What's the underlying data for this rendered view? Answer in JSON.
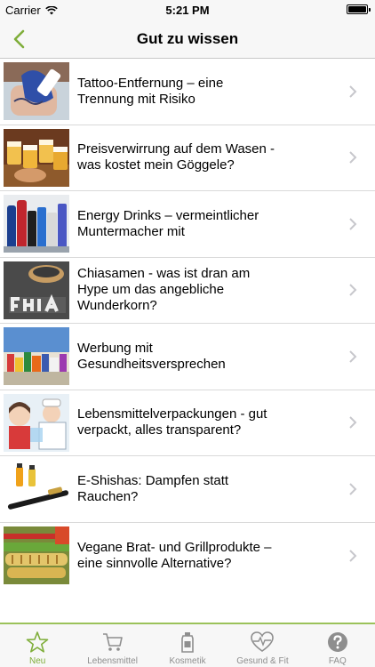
{
  "status": {
    "carrier": "Carrier",
    "time": "5:21 PM"
  },
  "nav": {
    "title": "Gut zu wissen"
  },
  "articles": [
    {
      "title": "Tattoo-Entfernung – eine Trennung mit Risiko",
      "thumb": "tattoo-removal-photo"
    },
    {
      "title": "Preisverwirrung auf dem Wasen - was kostet mein Göggele?",
      "thumb": "beer-festival-photo"
    },
    {
      "title": "Energy Drinks – vermeintlicher Muntermacher mit",
      "thumb": "energy-drinks-photo"
    },
    {
      "title": "Chiasamen - was ist dran am Hype um das angebliche Wunderkorn?",
      "thumb": "chia-seeds-photo"
    },
    {
      "title": "Werbung mit Gesundheitsversprechen",
      "thumb": "health-products-photo"
    },
    {
      "title": "Lebensmittelverpackungen - gut verpackt, alles transparent?",
      "thumb": "packaging-illustration"
    },
    {
      "title": "E-Shishas: Dampfen statt Rauchen?",
      "thumb": "e-shisha-photo"
    },
    {
      "title": "Vegane Brat- und Grillprodukte – eine sinnvolle Alternative?",
      "thumb": "vegan-grill-photo"
    }
  ],
  "tabs": [
    {
      "label": "Neu",
      "icon": "star-icon",
      "active": true
    },
    {
      "label": "Lebensmittel",
      "icon": "cart-icon",
      "active": false
    },
    {
      "label": "Kosmetik",
      "icon": "cosmetics-bottle-icon",
      "active": false
    },
    {
      "label": "Gesund & Fit",
      "icon": "heart-pulse-icon",
      "active": false
    },
    {
      "label": "FAQ",
      "icon": "question-icon",
      "active": false
    }
  ],
  "colors": {
    "accent": "#7fae3a",
    "tab_border": "#9bc25a",
    "inactive": "#8e8e8e"
  }
}
